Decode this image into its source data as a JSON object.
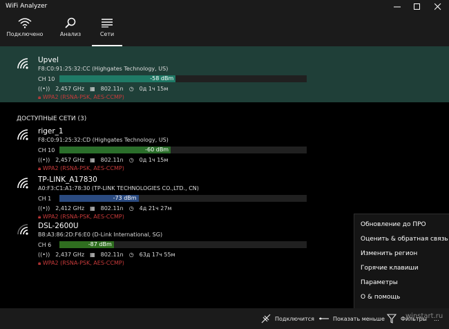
{
  "window": {
    "title": "WiFi Analyzer",
    "minimize_icon": "minimize-icon",
    "maximize_icon": "maximize-icon",
    "close_icon": "close-icon"
  },
  "tabs": [
    {
      "label": "Подключено",
      "icon": "wifi-icon",
      "active": false
    },
    {
      "label": "Анализ",
      "icon": "search-icon",
      "active": false
    },
    {
      "label": "Сети",
      "icon": "list-icon",
      "active": true
    }
  ],
  "connected": {
    "name": "Upvel",
    "mac": "F8:C0:91:25:32:CC  (Highgates Technology, US)",
    "channel": "CH 10",
    "signal": "-58 dBm",
    "signal_level": 0.47,
    "signal_color": "#1f7a66",
    "freq": "2,457 GHz",
    "standard": "802.11n",
    "uptime": "0д 1ч 15м",
    "security": "WPA2 (RSNA-PSK, AES-CCMP)"
  },
  "available": {
    "title": "ДОСТУПНЫЕ СЕТИ (3)",
    "networks": [
      {
        "name": "riger_1",
        "mac": "F8:C0:91:25:32:CD  (Highgates Technology, US)",
        "channel": "CH 10",
        "signal": "-60 dBm",
        "signal_level": 0.45,
        "signal_color": "#2b6e2b",
        "freq": "2,457 GHz",
        "standard": "802.11n",
        "uptime": "0д 1ч 15м",
        "security": "WPA2 (RSNA-PSK, AES-CCMP)"
      },
      {
        "name": "TP-LINK_A17830",
        "mac": "A0:F3:C1:A1:78:30  (TP-LINK TECHNOLOGIES CO.,LTD., CN)",
        "channel": "CH 1",
        "signal": "-73 dBm",
        "signal_level": 0.32,
        "signal_color": "#2a4a80",
        "freq": "2,412 GHz",
        "standard": "802.11n",
        "uptime": "4д 21ч 27м",
        "security": "WPA2 (RSNA-PSK, AES-CCMP)"
      },
      {
        "name": "DSL-2600U",
        "mac": "B8:A3:86:2D:F6:E0  (D-Link International, SG)",
        "channel": "CH 6",
        "signal": "-87 dBm",
        "signal_level": 0.22,
        "signal_color": "#2f6e1f",
        "freq": "2,437 GHz",
        "standard": "802.11n",
        "uptime": "63д 17ч 55м",
        "security": "WPA2 (RSNA-PSK, AES-CCMP)"
      }
    ]
  },
  "context_menu": {
    "items": [
      "Обновление до ПРО",
      "Оценить & обратная связь",
      "Изменить регион",
      "Горячие клавиши",
      "Параметры",
      "О & помощь"
    ]
  },
  "bottombar": {
    "connect_label": "Подключится",
    "show_less_label": "Показать меньше",
    "filters_label": "Фильтры",
    "more_label": "..."
  },
  "watermark": "winstart.ru"
}
